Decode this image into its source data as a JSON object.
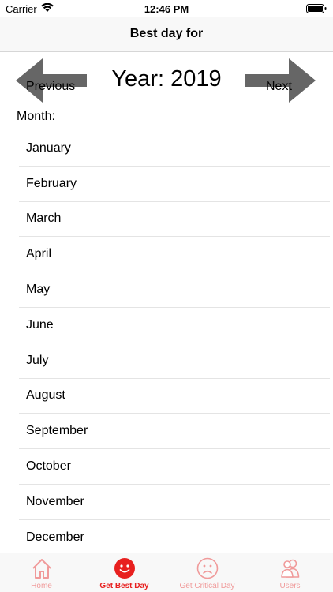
{
  "status_bar": {
    "carrier": "Carrier",
    "time": "12:46 PM"
  },
  "nav": {
    "title": "Best day for"
  },
  "year_selector": {
    "previous_label": "Previous",
    "year_title": "Year: 2019",
    "next_label": "Next"
  },
  "month_heading": "Month:",
  "months": [
    "January",
    "February",
    "March",
    "April",
    "May",
    "June",
    "July",
    "August",
    "September",
    "October",
    "November",
    "December"
  ],
  "tabs": [
    {
      "label": "Home",
      "icon": "home-icon",
      "active": false
    },
    {
      "label": "Get Best Day",
      "icon": "smile-icon",
      "active": true
    },
    {
      "label": "Get Critical Day",
      "icon": "frown-icon",
      "active": false
    },
    {
      "label": "Users",
      "icon": "users-icon",
      "active": false
    }
  ],
  "colors": {
    "accent": "#e8201f",
    "inactive_tab": "#f09a9a",
    "arrow": "#666666"
  }
}
